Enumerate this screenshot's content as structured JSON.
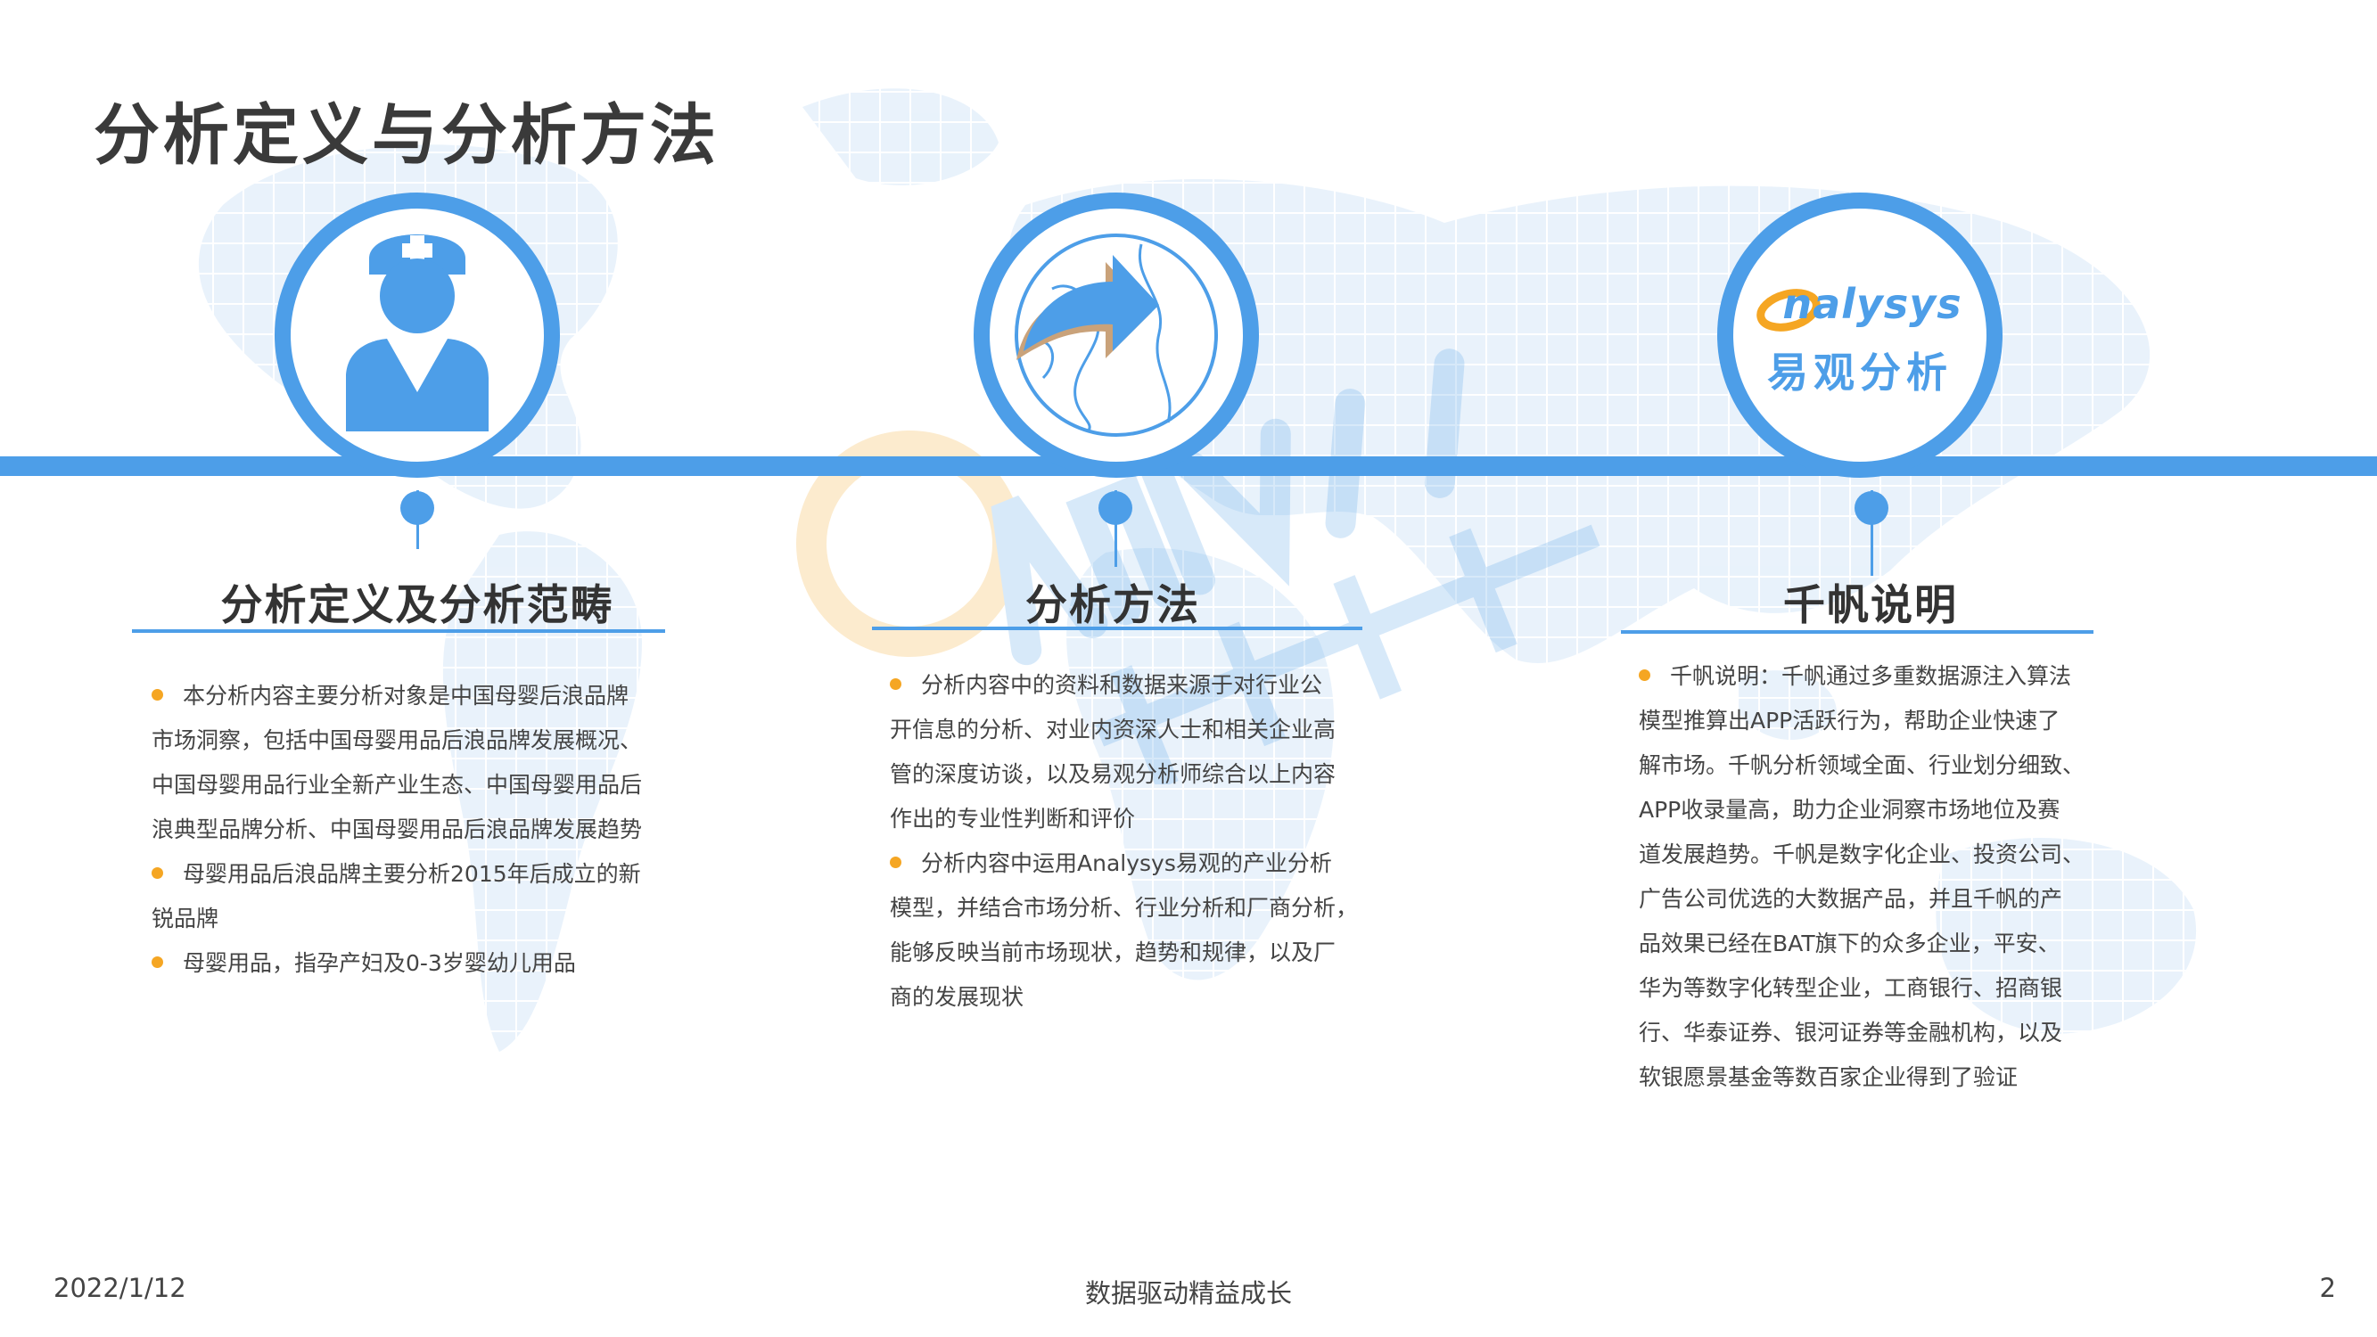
{
  "page": {
    "title": "分析定义与分析方法",
    "footer_date": "2022/1/12",
    "footer_center": "数据驱动精益成长",
    "page_number": "2"
  },
  "colors": {
    "accent": "#4d9ee8",
    "bullet": "#f5a623",
    "text": "#333333"
  },
  "brand": {
    "logo_en": "nalysys",
    "logo_cn": "易观分析"
  },
  "sections": [
    {
      "icon": "nurse-icon",
      "title": "分析定义及分析范畴",
      "bullets": [
        [
          "本分析内容主要分析对象是中国母婴后浪品牌",
          "市场洞察，包括中国母婴用品后浪品牌发展概况、",
          "中国母婴用品行业全新产业生态、中国母婴用品后",
          "浪典型品牌分析、中国母婴用品后浪品牌发展趋势"
        ],
        [
          "母婴用品后浪品牌主要分析2015年后成立的新",
          "锐品牌"
        ],
        [
          "母婴用品，指孕产妇及0-3岁婴幼儿用品"
        ]
      ]
    },
    {
      "icon": "globe-arrow-icon",
      "title": "分析方法",
      "bullets": [
        [
          "分析内容中的资料和数据来源于对行业公",
          "开信息的分析、对业内资深人士和相关企业高",
          "管的深度访谈，以及易观分析师综合以上内容",
          "作出的专业性判断和评价"
        ],
        [
          "分析内容中运用Analysys易观的产业分析",
          "模型，并结合市场分析、行业分析和厂商分析，",
          "能够反映当前市场现状，趋势和规律，以及厂",
          "商的发展现状"
        ]
      ]
    },
    {
      "icon": "analysys-logo-icon",
      "title": "千帆说明",
      "bullets": [
        [
          "千帆说明：千帆通过多重数据源注入算法",
          "模型推算出APP活跃行为，帮助企业快速了",
          "解市场。千帆分析领域全面、行业划分细致、",
          "APP收录量高，助力企业洞察市场地位及赛",
          "道发展趋势。千帆是数字化企业、投资公司、",
          "广告公司优选的大数据产品，并且千帆的产",
          "品效果已经在BAT旗下的众多企业，平安、",
          "华为等数字化转型企业，工商银行、招商银",
          "行、华泰证券、银河证券等金融机构，以及",
          "软银愿景基金等数百家企业得到了验证"
        ]
      ]
    }
  ]
}
